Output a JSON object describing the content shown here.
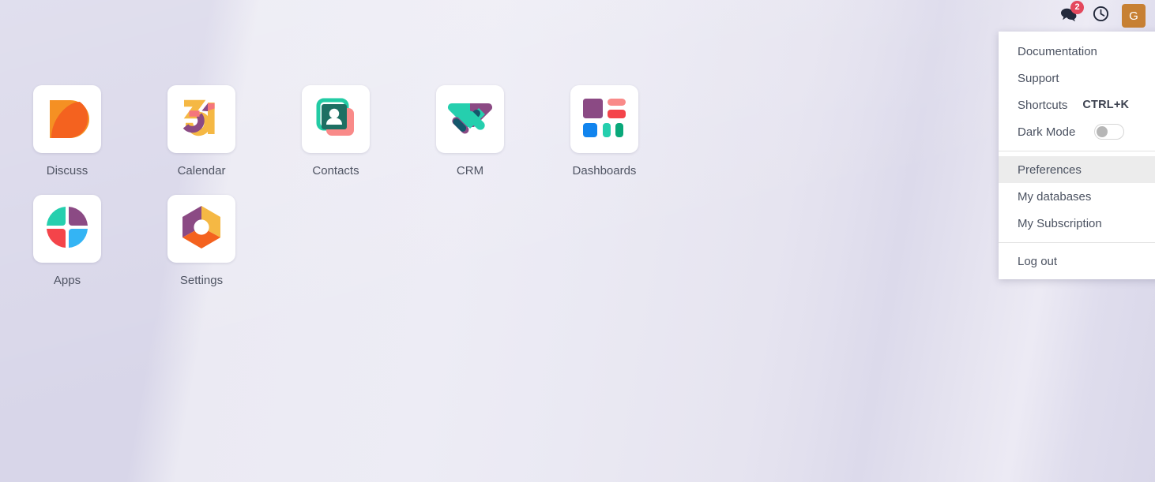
{
  "topbar": {
    "messages": {
      "icon": "chat-bubbles-icon",
      "badge_count": "2"
    },
    "activities": {
      "icon": "clock-icon"
    },
    "avatar": {
      "initial": "G",
      "color": "#c78033"
    }
  },
  "user_menu": {
    "sections": [
      {
        "items": [
          {
            "label": "Documentation",
            "name": "documentation",
            "shortcut": ""
          },
          {
            "label": "Support",
            "name": "support",
            "shortcut": ""
          },
          {
            "label": "Shortcuts",
            "name": "shortcuts",
            "shortcut": "CTRL+K"
          },
          {
            "label": "Dark Mode",
            "name": "dark-mode",
            "shortcut": "",
            "toggle": false
          }
        ]
      },
      {
        "items": [
          {
            "label": "Preferences",
            "name": "preferences",
            "shortcut": "",
            "active": true
          },
          {
            "label": "My databases",
            "name": "my-databases",
            "shortcut": ""
          },
          {
            "label": "My Subscription",
            "name": "my-subscription",
            "shortcut": ""
          }
        ]
      },
      {
        "items": [
          {
            "label": "Log out",
            "name": "log-out",
            "shortcut": ""
          }
        ]
      }
    ]
  },
  "apps": [
    {
      "label": "Discuss",
      "icon": "discuss-icon"
    },
    {
      "label": "Calendar",
      "icon": "calendar-31-icon"
    },
    {
      "label": "Contacts",
      "icon": "contacts-icon"
    },
    {
      "label": "CRM",
      "icon": "crm-handshake-icon"
    },
    {
      "label": "Dashboards",
      "icon": "dashboards-icon"
    },
    {
      "label": "Apps",
      "icon": "apps-circle-icon"
    },
    {
      "label": "Settings",
      "icon": "settings-hexagon-icon"
    }
  ],
  "colors": {
    "background": "#d7d5e8",
    "accent_avatar": "#c78033",
    "badge_red": "#e4485d",
    "menu_text": "#4b5261",
    "tile_white": "#ffffff"
  }
}
